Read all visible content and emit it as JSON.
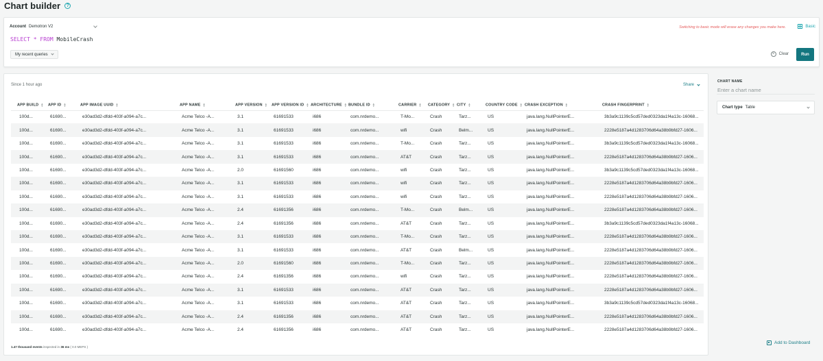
{
  "page": {
    "title": "Chart builder",
    "help_icon": "?"
  },
  "query": {
    "account_label": "Account",
    "account_value": "Demotron V2",
    "nrql_keyword_select": "SELECT",
    "nrql_star": "*",
    "nrql_keyword_from": "FROM",
    "nrql_table": "MobileCrash",
    "recent_queries_label": "My recent queries",
    "warning": "Switching to basic mode will erase any changes you make here.",
    "basic_label": "Basic",
    "clear_label": "Clear",
    "run_label": "Run"
  },
  "results": {
    "since": "Since 1 hour ago",
    "share_label": "Share",
    "columns": [
      "APP BUILD",
      "APP ID",
      "APP IMAGE UUID",
      "APP NAME",
      "APP VERSION",
      "APP VERSION ID",
      "ARCHITECTURE",
      "BUNDLE ID",
      "CARRIER",
      "CATEGORY",
      "CITY",
      "COUNTRY CODE",
      "CRASH EXCEPTION",
      "CRASH FINGERPRINT"
    ],
    "rows": [
      [
        "100d...",
        "61690...",
        "e30ad3d2-dfdd-403f-a094-a7c...",
        "Acme Telco -A...",
        "3.1",
        "61691533",
        "i686",
        "com.nrdemo...",
        "T-Mo...",
        "Crash",
        "Tarz...",
        "US",
        "java.lang.NullPointerE...",
        "3b3a9c1139c5cd57ded0323da1f4a13c-16068..."
      ],
      [
        "100d...",
        "61690...",
        "e30ad3d2-dfdd-403f-a094-a7c...",
        "Acme Telco -A...",
        "3.1",
        "61691533",
        "i686",
        "com.nrdemo...",
        "wifi",
        "Crash",
        "Belm...",
        "US",
        "java.lang.NullPointerE...",
        "2228e5187a4d1283706d64a38b9bfd27-1606..."
      ],
      [
        "100d...",
        "61690...",
        "e30ad3d2-dfdd-403f-a094-a7c...",
        "Acme Telco -A...",
        "3.1",
        "61691533",
        "i686",
        "com.nrdemo...",
        "T-Mo...",
        "Crash",
        "Tarz...",
        "US",
        "java.lang.NullPointerE...",
        "3b3a9c1139c5cd57ded0323da1f4a13c-16068..."
      ],
      [
        "100d...",
        "61690...",
        "e30ad3d2-dfdd-403f-a094-a7c...",
        "Acme Telco -A...",
        "3.1",
        "61691533",
        "i686",
        "com.nrdemo...",
        "AT&T",
        "Crash",
        "Tarz...",
        "US",
        "java.lang.NullPointerE...",
        "2228e5187a4d1283706d64a38b9bfd27-1606..."
      ],
      [
        "100d...",
        "61690...",
        "e30ad3d2-dfdd-403f-a094-a7c...",
        "Acme Telco -A...",
        "2.0",
        "61691560",
        "i686",
        "com.nrdemo...",
        "wifi",
        "Crash",
        "Tarz...",
        "US",
        "java.lang.NullPointerE...",
        "3b3a9c1139c5cd57ded0323da1f4a13c-16068..."
      ],
      [
        "100d...",
        "61690...",
        "e30ad3d2-dfdd-403f-a094-a7c...",
        "Acme Telco -A...",
        "3.1",
        "61691533",
        "i686",
        "com.nrdemo...",
        "wifi",
        "Crash",
        "Tarz...",
        "US",
        "java.lang.NullPointerE...",
        "2228e5187a4d1283706d64a38b9bfd27-1606..."
      ],
      [
        "100d...",
        "61690...",
        "e30ad3d2-dfdd-403f-a094-a7c...",
        "Acme Telco -A...",
        "3.1",
        "61691533",
        "i686",
        "com.nrdemo...",
        "wifi",
        "Crash",
        "Tarz...",
        "US",
        "java.lang.NullPointerE...",
        "2228e5187a4d1283706d64a38b9bfd27-1606..."
      ],
      [
        "100d...",
        "61690...",
        "e30ad3d2-dfdd-403f-a094-a7c...",
        "Acme Telco -A...",
        "2.4",
        "61691356",
        "i686",
        "com.nrdemo...",
        "T-Mo...",
        "Crash",
        "Belm...",
        "US",
        "java.lang.NullPointerE...",
        "2228e5187a4d1283706d64a38b9bfd27-1606..."
      ],
      [
        "100d...",
        "61690...",
        "e30ad3d2-dfdd-403f-a094-a7c...",
        "Acme Telco -A...",
        "2.4",
        "61691356",
        "i686",
        "com.nrdemo...",
        "AT&T",
        "Crash",
        "Tarz...",
        "US",
        "java.lang.NullPointerE...",
        "3b3a9c1139c5cd57ded0323da1f4a13c-16068..."
      ],
      [
        "100d...",
        "61690...",
        "e30ad3d2-dfdd-403f-a094-a7c...",
        "Acme Telco -A...",
        "3.1",
        "61691533",
        "i686",
        "com.nrdemo...",
        "T-Mo...",
        "Crash",
        "Tarz...",
        "US",
        "java.lang.NullPointerE...",
        "2228e5187a4d1283706d64a38b9bfd27-1606..."
      ],
      [
        "100d...",
        "61690...",
        "e30ad3d2-dfdd-403f-a094-a7c...",
        "Acme Telco -A...",
        "3.1",
        "61691533",
        "i686",
        "com.nrdemo...",
        "AT&T",
        "Crash",
        "Belm...",
        "US",
        "java.lang.NullPointerE...",
        "2228e5187a4d1283706d64a38b9bfd27-1606..."
      ],
      [
        "100d...",
        "61690...",
        "e30ad3d2-dfdd-403f-a094-a7c...",
        "Acme Telco -A...",
        "2.0",
        "61691560",
        "i686",
        "com.nrdemo...",
        "T-Mo...",
        "Crash",
        "Tarz...",
        "US",
        "java.lang.NullPointerE...",
        "2228e5187a4d1283706d64a38b9bfd27-1606..."
      ],
      [
        "100d...",
        "61690...",
        "e30ad3d2-dfdd-403f-a094-a7c...",
        "Acme Telco -A...",
        "2.4",
        "61691356",
        "i686",
        "com.nrdemo...",
        "wifi",
        "Crash",
        "Tarz...",
        "US",
        "java.lang.NullPointerE...",
        "2228e5187a4d1283706d64a38b9bfd27-1606..."
      ],
      [
        "100d...",
        "61690...",
        "e30ad3d2-dfdd-403f-a094-a7c...",
        "Acme Telco -A...",
        "3.1",
        "61691533",
        "i686",
        "com.nrdemo...",
        "AT&T",
        "Crash",
        "Tarz...",
        "US",
        "java.lang.NullPointerE...",
        "2228e5187a4d1283706d64a38b9bfd27-1606..."
      ],
      [
        "100d...",
        "61690...",
        "e30ad3d2-dfdd-403f-a094-a7c...",
        "Acme Telco -A...",
        "3.1",
        "61691533",
        "i686",
        "com.nrdemo...",
        "AT&T",
        "Crash",
        "Tarz...",
        "US",
        "java.lang.NullPointerE...",
        "3b3a9c1139c5cd57ded0323da1f4a13c-16068..."
      ],
      [
        "100d...",
        "61690...",
        "e30ad3d2-dfdd-403f-a094-a7c...",
        "Acme Telco -A...",
        "2.4",
        "61691356",
        "i686",
        "com.nrdemo...",
        "AT&T",
        "Crash",
        "Tarz...",
        "US",
        "java.lang.NullPointerE...",
        "2228e5187a4d1283706d64a38b9bfd27-1606..."
      ],
      [
        "100d...",
        "61690...",
        "e30ad3d2-dfdd-403f-a094-a7c...",
        "Acme Telco -A...",
        "2.4",
        "61691356",
        "i686",
        "com.nrdemo...",
        "AT&T",
        "Crash",
        "Tarz...",
        "US",
        "java.lang.NullPointerE...",
        "2228e5187a4d1283706d64a38b9bfd27-1606..."
      ]
    ],
    "footer_events": "1.47 thousand events",
    "footer_inspected": "inspected in",
    "footer_ms": "36 ms",
    "footer_mbps": "( 0.0 MEPS )"
  },
  "side": {
    "chart_name_label": "CHART NAME",
    "chart_name_placeholder": "Enter a chart name",
    "chart_type_label": "Chart type",
    "chart_type_value": "Table",
    "add_dashboard_label": "Add to Dashboard"
  },
  "colors": {
    "accent": "#13767f",
    "keyword": "#b83fd1",
    "warning": "#e55c5c"
  }
}
